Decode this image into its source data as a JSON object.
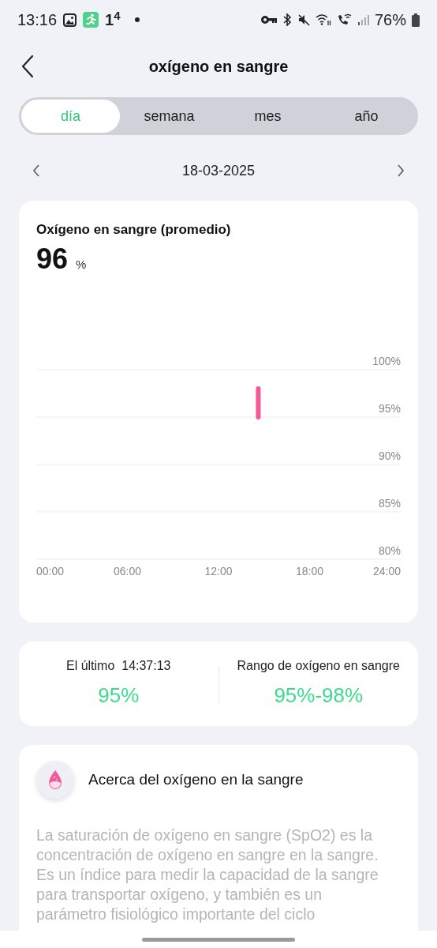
{
  "status_bar": {
    "time": "13:16",
    "notification_count": "1$^{4}$",
    "battery": "76%"
  },
  "header": {
    "title": "oxígeno en sangre"
  },
  "tabs": [
    {
      "label": "día",
      "selected": true
    },
    {
      "label": "semana",
      "selected": false
    },
    {
      "label": "mes",
      "selected": false
    },
    {
      "label": "año",
      "selected": false
    }
  ],
  "date_nav": {
    "date": "18-03-2025"
  },
  "summary_card": {
    "title": "Oxígeno en sangre (promedio)",
    "value": "96",
    "unit": "%",
    "chart_data": {
      "type": "line",
      "x": [
        14.62,
        14.62
      ],
      "series": [
        {
          "color": "#f5589a",
          "values": [
            95,
            98
          ]
        }
      ],
      "xlim": [
        0,
        24
      ],
      "ylim": [
        80,
        100
      ],
      "grid": true,
      "xticks": [
        {
          "value": 0,
          "label": "00:00"
        },
        {
          "value": 6,
          "label": "06:00"
        },
        {
          "value": 12,
          "label": "12:00"
        },
        {
          "value": 18,
          "label": "18:00"
        },
        {
          "value": 24,
          "label": "24:00"
        }
      ],
      "yticks": [
        {
          "value": 100,
          "label": "100%"
        },
        {
          "value": 95,
          "label": "95%"
        },
        {
          "value": 90,
          "label": "90%"
        },
        {
          "value": 85,
          "label": "85%"
        },
        {
          "value": 80,
          "label": "80%"
        }
      ]
    }
  },
  "stats": [
    {
      "label": "El último  14:37:13",
      "value": "95%"
    },
    {
      "label": "Rango de oxígeno en sangre",
      "value": "95%-98%"
    }
  ],
  "info_card": {
    "title": "Acerca del oxígeno en la sangre",
    "text": "La saturación de oxígeno en sangre (SpO2) es la concentración de oxígeno en sangre en la sangre. Es un índice para medir la capacidad de la sangre para transportar oxígeno, y también es un parámetro fisiológico importante del ciclo"
  }
}
